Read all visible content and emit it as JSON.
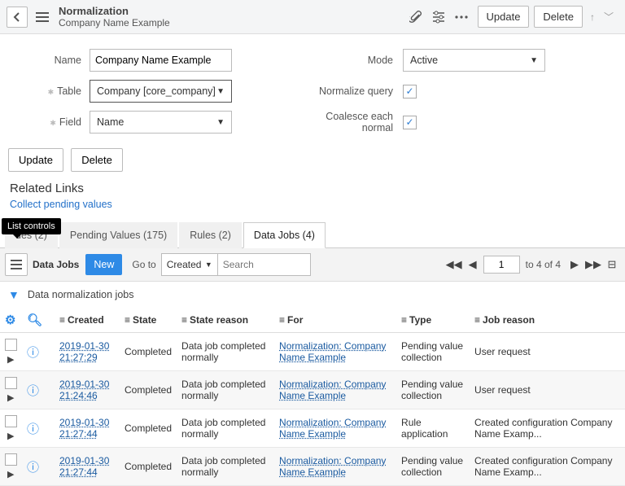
{
  "header": {
    "title": "Normalization",
    "subtitle": "Company Name Example",
    "update_label": "Update",
    "delete_label": "Delete"
  },
  "form": {
    "name_label": "Name",
    "name_value": "Company Name Example",
    "table_label": "Table",
    "table_value": "Company [core_company]",
    "field_label": "Field",
    "field_value": "Name",
    "mode_label": "Mode",
    "mode_value": "Active",
    "normalize_label": "Normalize query",
    "normalize_checked": "✓",
    "coalesce_label": "Coalesce each normal",
    "coalesce_checked": "✓",
    "update_btn": "Update",
    "delete_btn": "Delete"
  },
  "related": {
    "header": "Related Links",
    "collect_link": "Collect pending values"
  },
  "tabs": {
    "tooltip": "List controls",
    "items": [
      {
        "label": "ues (2)"
      },
      {
        "label": "Pending Values (175)"
      },
      {
        "label": "Rules (2)"
      },
      {
        "label": "Data Jobs (4)"
      }
    ]
  },
  "list": {
    "title": "Data Jobs",
    "new_label": "New",
    "goto_label": "Go to",
    "goto_value": "Created",
    "search_placeholder": "Search",
    "page_value": "1",
    "page_text": "to 4 of 4",
    "filter_text": "Data normalization jobs",
    "columns": {
      "created": "Created",
      "state": "State",
      "reason": "State reason",
      "for": "For",
      "type": "Type",
      "job_reason": "Job reason"
    },
    "rows": [
      {
        "created": "2019-01-30 21:27:29",
        "state": "Completed",
        "reason": "Data job completed normally",
        "for": "Normalization: Company Name Example",
        "type": "Pending value collection",
        "job_reason": "User request"
      },
      {
        "created": "2019-01-30 21:24:46",
        "state": "Completed",
        "reason": "Data job completed normally",
        "for": "Normalization: Company Name Example",
        "type": "Pending value collection",
        "job_reason": "User request"
      },
      {
        "created": "2019-01-30 21:27:44",
        "state": "Completed",
        "reason": "Data job completed normally",
        "for": "Normalization: Company Name Example",
        "type": "Rule application",
        "job_reason": "Created configuration Company Name Examp..."
      },
      {
        "created": "2019-01-30 21:27:44",
        "state": "Completed",
        "reason": "Data job completed normally",
        "for": "Normalization: Company Name Example",
        "type": "Pending value collection",
        "job_reason": "Created configuration Company Name Examp..."
      }
    ]
  }
}
